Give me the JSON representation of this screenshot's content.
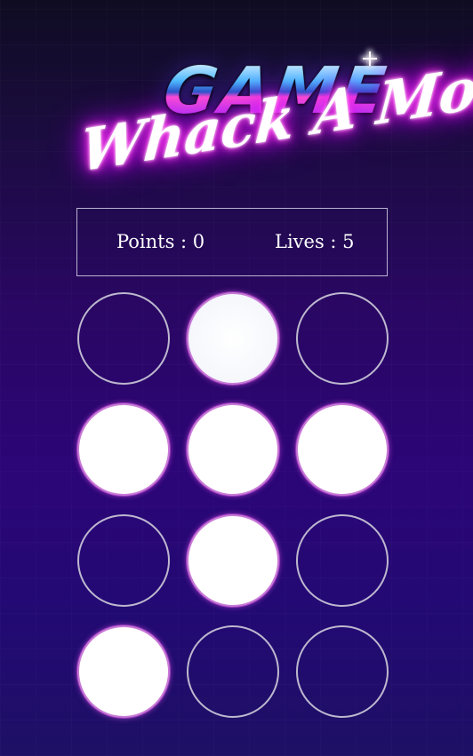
{
  "logo": {
    "game_text": "GAME",
    "title_text": "Whack A Mole"
  },
  "scoreboard": {
    "points_text": "Points : 0",
    "lives_text": "Lives : 5",
    "points": 0,
    "lives": 5
  },
  "board": {
    "rows": 4,
    "columns": 3,
    "holes": [
      {
        "row": 1,
        "col": 1,
        "active": false
      },
      {
        "row": 1,
        "col": 2,
        "active": true
      },
      {
        "row": 1,
        "col": 3,
        "active": false
      },
      {
        "row": 2,
        "col": 1,
        "active": true
      },
      {
        "row": 2,
        "col": 2,
        "active": true
      },
      {
        "row": 2,
        "col": 3,
        "active": true
      },
      {
        "row": 3,
        "col": 1,
        "active": false
      },
      {
        "row": 3,
        "col": 2,
        "active": true
      },
      {
        "row": 3,
        "col": 3,
        "active": false
      },
      {
        "row": 4,
        "col": 1,
        "active": true
      },
      {
        "row": 4,
        "col": 2,
        "active": false
      },
      {
        "row": 4,
        "col": 3,
        "active": false
      }
    ]
  },
  "colors": {
    "background_top": "#0f0c22",
    "background_bottom": "#1e1064",
    "neon_pink": "#ff2ae0",
    "hole_outline": "#bdb8cf",
    "hole_active_fill": "#ffffff"
  }
}
